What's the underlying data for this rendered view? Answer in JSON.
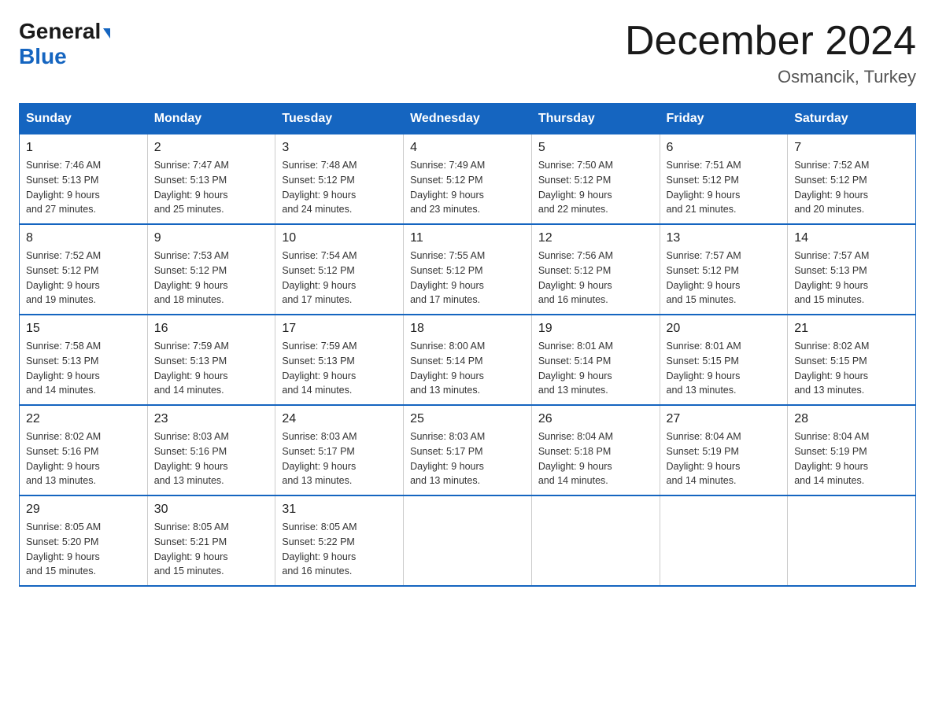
{
  "logo": {
    "general": "General",
    "blue": "Blue",
    "triangle": "▶"
  },
  "header": {
    "title": "December 2024",
    "location": "Osmancik, Turkey"
  },
  "columns": [
    "Sunday",
    "Monday",
    "Tuesday",
    "Wednesday",
    "Thursday",
    "Friday",
    "Saturday"
  ],
  "weeks": [
    [
      {
        "day": "1",
        "sunrise": "7:46 AM",
        "sunset": "5:13 PM",
        "daylight": "9 hours and 27 minutes."
      },
      {
        "day": "2",
        "sunrise": "7:47 AM",
        "sunset": "5:13 PM",
        "daylight": "9 hours and 25 minutes."
      },
      {
        "day": "3",
        "sunrise": "7:48 AM",
        "sunset": "5:12 PM",
        "daylight": "9 hours and 24 minutes."
      },
      {
        "day": "4",
        "sunrise": "7:49 AM",
        "sunset": "5:12 PM",
        "daylight": "9 hours and 23 minutes."
      },
      {
        "day": "5",
        "sunrise": "7:50 AM",
        "sunset": "5:12 PM",
        "daylight": "9 hours and 22 minutes."
      },
      {
        "day": "6",
        "sunrise": "7:51 AM",
        "sunset": "5:12 PM",
        "daylight": "9 hours and 21 minutes."
      },
      {
        "day": "7",
        "sunrise": "7:52 AM",
        "sunset": "5:12 PM",
        "daylight": "9 hours and 20 minutes."
      }
    ],
    [
      {
        "day": "8",
        "sunrise": "7:52 AM",
        "sunset": "5:12 PM",
        "daylight": "9 hours and 19 minutes."
      },
      {
        "day": "9",
        "sunrise": "7:53 AM",
        "sunset": "5:12 PM",
        "daylight": "9 hours and 18 minutes."
      },
      {
        "day": "10",
        "sunrise": "7:54 AM",
        "sunset": "5:12 PM",
        "daylight": "9 hours and 17 minutes."
      },
      {
        "day": "11",
        "sunrise": "7:55 AM",
        "sunset": "5:12 PM",
        "daylight": "9 hours and 17 minutes."
      },
      {
        "day": "12",
        "sunrise": "7:56 AM",
        "sunset": "5:12 PM",
        "daylight": "9 hours and 16 minutes."
      },
      {
        "day": "13",
        "sunrise": "7:57 AM",
        "sunset": "5:12 PM",
        "daylight": "9 hours and 15 minutes."
      },
      {
        "day": "14",
        "sunrise": "7:57 AM",
        "sunset": "5:13 PM",
        "daylight": "9 hours and 15 minutes."
      }
    ],
    [
      {
        "day": "15",
        "sunrise": "7:58 AM",
        "sunset": "5:13 PM",
        "daylight": "9 hours and 14 minutes."
      },
      {
        "day": "16",
        "sunrise": "7:59 AM",
        "sunset": "5:13 PM",
        "daylight": "9 hours and 14 minutes."
      },
      {
        "day": "17",
        "sunrise": "7:59 AM",
        "sunset": "5:13 PM",
        "daylight": "9 hours and 14 minutes."
      },
      {
        "day": "18",
        "sunrise": "8:00 AM",
        "sunset": "5:14 PM",
        "daylight": "9 hours and 13 minutes."
      },
      {
        "day": "19",
        "sunrise": "8:01 AM",
        "sunset": "5:14 PM",
        "daylight": "9 hours and 13 minutes."
      },
      {
        "day": "20",
        "sunrise": "8:01 AM",
        "sunset": "5:15 PM",
        "daylight": "9 hours and 13 minutes."
      },
      {
        "day": "21",
        "sunrise": "8:02 AM",
        "sunset": "5:15 PM",
        "daylight": "9 hours and 13 minutes."
      }
    ],
    [
      {
        "day": "22",
        "sunrise": "8:02 AM",
        "sunset": "5:16 PM",
        "daylight": "9 hours and 13 minutes."
      },
      {
        "day": "23",
        "sunrise": "8:03 AM",
        "sunset": "5:16 PM",
        "daylight": "9 hours and 13 minutes."
      },
      {
        "day": "24",
        "sunrise": "8:03 AM",
        "sunset": "5:17 PM",
        "daylight": "9 hours and 13 minutes."
      },
      {
        "day": "25",
        "sunrise": "8:03 AM",
        "sunset": "5:17 PM",
        "daylight": "9 hours and 13 minutes."
      },
      {
        "day": "26",
        "sunrise": "8:04 AM",
        "sunset": "5:18 PM",
        "daylight": "9 hours and 14 minutes."
      },
      {
        "day": "27",
        "sunrise": "8:04 AM",
        "sunset": "5:19 PM",
        "daylight": "9 hours and 14 minutes."
      },
      {
        "day": "28",
        "sunrise": "8:04 AM",
        "sunset": "5:19 PM",
        "daylight": "9 hours and 14 minutes."
      }
    ],
    [
      {
        "day": "29",
        "sunrise": "8:05 AM",
        "sunset": "5:20 PM",
        "daylight": "9 hours and 15 minutes."
      },
      {
        "day": "30",
        "sunrise": "8:05 AM",
        "sunset": "5:21 PM",
        "daylight": "9 hours and 15 minutes."
      },
      {
        "day": "31",
        "sunrise": "8:05 AM",
        "sunset": "5:22 PM",
        "daylight": "9 hours and 16 minutes."
      },
      null,
      null,
      null,
      null
    ]
  ]
}
